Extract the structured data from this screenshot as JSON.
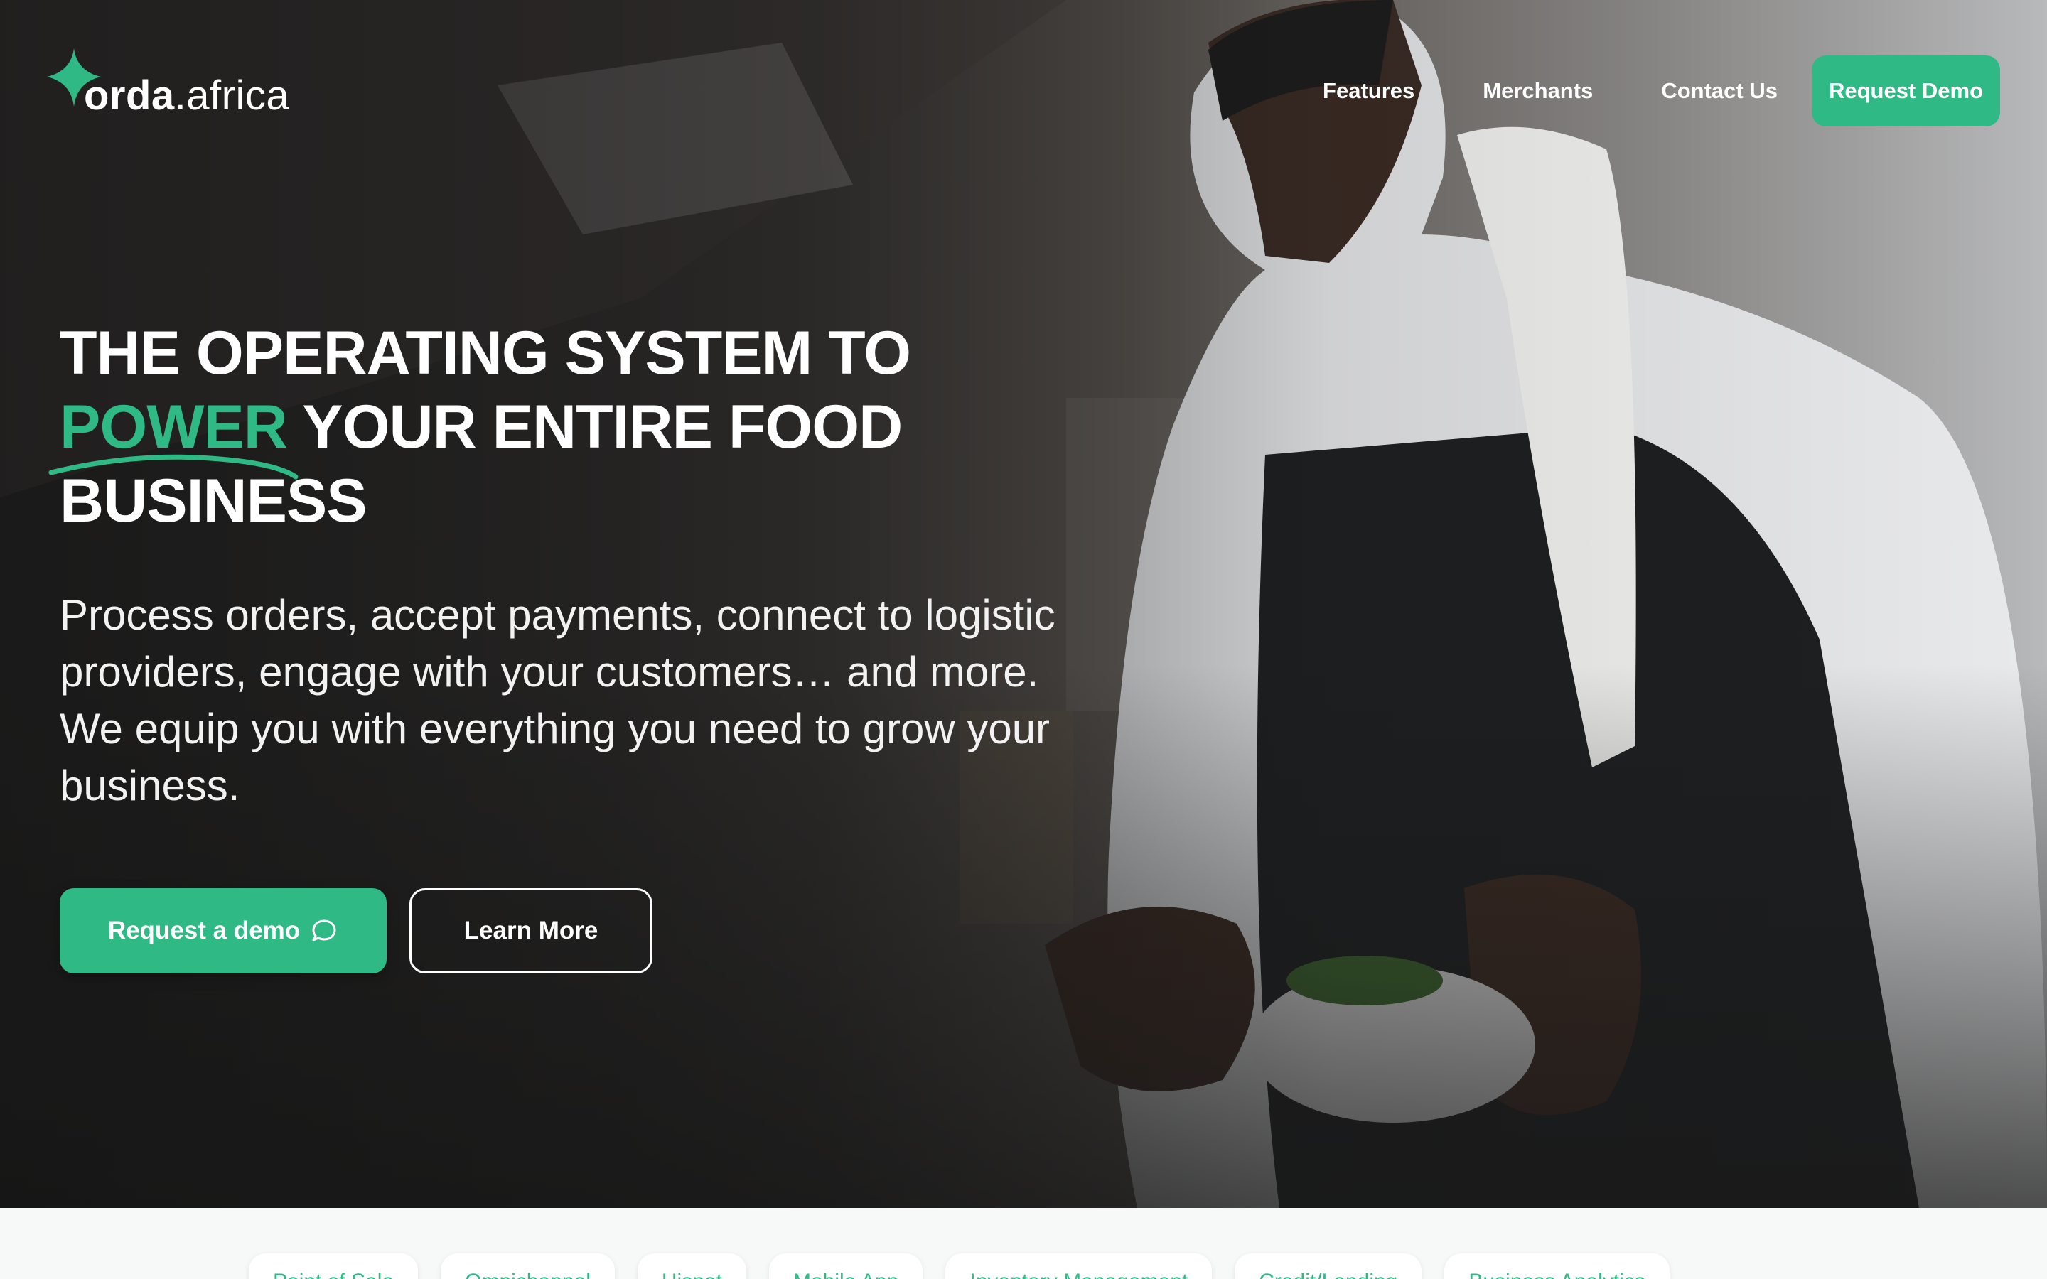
{
  "brand": {
    "name_bold": "orda",
    "name_light": ".africa",
    "accent_color": "#2fba85",
    "logo_icon": "sparkle-star-icon"
  },
  "nav": {
    "items": [
      {
        "label": "Features"
      },
      {
        "label": "Merchants"
      },
      {
        "label": "Contact Us"
      }
    ],
    "cta_label": "Request Demo"
  },
  "hero": {
    "headline_line1": "THE OPERATING SYSTEM TO",
    "headline_accent": "POWER",
    "headline_line2_rest": " YOUR ENTIRE FOOD",
    "headline_line3": "BUSINESS",
    "subtext": "Process orders, accept payments, connect to logistic providers, engage with your customers… and more. We equip you with everything you need to grow your business.",
    "primary_button_label": "Request a demo",
    "primary_button_icon": "chat-bubble-icon",
    "secondary_button_label": "Learn More"
  },
  "feature_tabs": [
    {
      "label": "Point of Sale"
    },
    {
      "label": "Omnichannel"
    },
    {
      "label": "Hispot"
    },
    {
      "label": "Mobile App"
    },
    {
      "label": "Inventory Management"
    },
    {
      "label": "Credit/Lending"
    },
    {
      "label": "Business Analytics"
    }
  ]
}
